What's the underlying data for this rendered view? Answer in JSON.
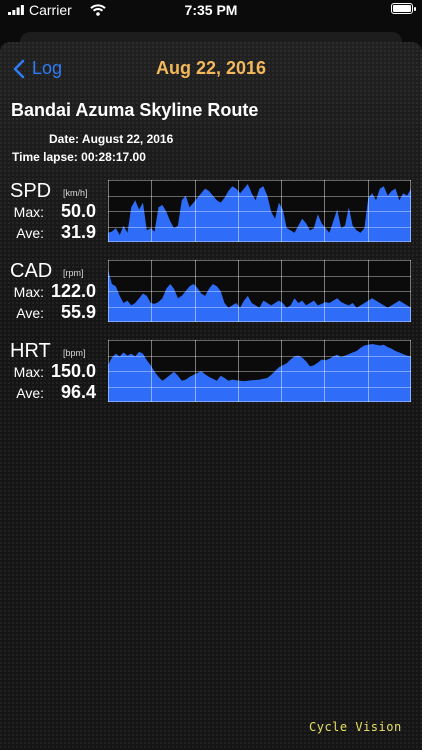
{
  "status_bar": {
    "carrier": "Carrier",
    "time": "7:35 PM"
  },
  "nav": {
    "back_label": "Log",
    "title": "Aug 22, 2016"
  },
  "route": {
    "title": "Bandai Azuma Skyline Route",
    "date_label": "Date:",
    "date": "August 22, 2016",
    "time_lapse_label": "Time lapse:",
    "time_lapse": "00:28:17.00"
  },
  "metric_labels": {
    "max": "Max:",
    "ave": "Ave:"
  },
  "metrics": [
    {
      "name": "SPD",
      "unit": "[km/h]",
      "max": "50.0",
      "ave": "31.9",
      "series": [
        8,
        9,
        12,
        6,
        14,
        8,
        30,
        36,
        28,
        34,
        10,
        12,
        9,
        30,
        32,
        26,
        18,
        12,
        14,
        36,
        40,
        30,
        34,
        38,
        42,
        46,
        44,
        40,
        36,
        34,
        38,
        44,
        48,
        46,
        42,
        46,
        50,
        42,
        36,
        46,
        48,
        40,
        26,
        20,
        34,
        28,
        12,
        10,
        8,
        14,
        20,
        16,
        10,
        12,
        24,
        16,
        12,
        8,
        18,
        28,
        12,
        14,
        30,
        14,
        10,
        8,
        12,
        38,
        42,
        36,
        46,
        48,
        40,
        44,
        46,
        36,
        42,
        40,
        46
      ]
    },
    {
      "name": "CAD",
      "unit": "[rpm]",
      "max": "122.0",
      "ave": "55.9",
      "series": [
        110,
        80,
        75,
        55,
        40,
        45,
        35,
        40,
        50,
        60,
        55,
        40,
        38,
        42,
        50,
        70,
        80,
        70,
        50,
        55,
        65,
        75,
        80,
        72,
        60,
        55,
        70,
        80,
        75,
        65,
        40,
        30,
        35,
        40,
        30,
        45,
        55,
        40,
        35,
        30,
        45,
        40,
        35,
        40,
        45,
        40,
        30,
        35,
        50,
        40,
        45,
        35,
        40,
        45,
        35,
        38,
        42,
        40,
        45,
        50,
        42,
        38,
        35,
        40,
        30,
        35,
        40,
        45,
        50,
        45,
        40,
        35,
        30,
        35,
        40,
        45,
        40,
        35,
        30
      ]
    },
    {
      "name": "HRT",
      "unit": "[bpm]",
      "max": "150.0",
      "ave": "96.4",
      "series": [
        95,
        115,
        125,
        118,
        128,
        120,
        125,
        118,
        130,
        125,
        108,
        95,
        78,
        65,
        55,
        62,
        70,
        78,
        68,
        55,
        58,
        65,
        70,
        75,
        80,
        72,
        65,
        60,
        55,
        68,
        62,
        55,
        58,
        56,
        55,
        54,
        55,
        56,
        57,
        58,
        60,
        62,
        70,
        80,
        90,
        95,
        100,
        110,
        118,
        120,
        115,
        105,
        92,
        95,
        102,
        110,
        108,
        112,
        118,
        122,
        116,
        120,
        124,
        128,
        132,
        140,
        146,
        148,
        150,
        148,
        146,
        148,
        142,
        138,
        132,
        128,
        124,
        120,
        118
      ]
    }
  ],
  "chart_style": {
    "fill": "#2f6cf8",
    "grid": "#ffffff",
    "background": "#0b0b0b",
    "accent": "#f2b85a",
    "link": "#2f7cf6",
    "brand": "#e8e060"
  },
  "brand": "Cycle Vision"
}
